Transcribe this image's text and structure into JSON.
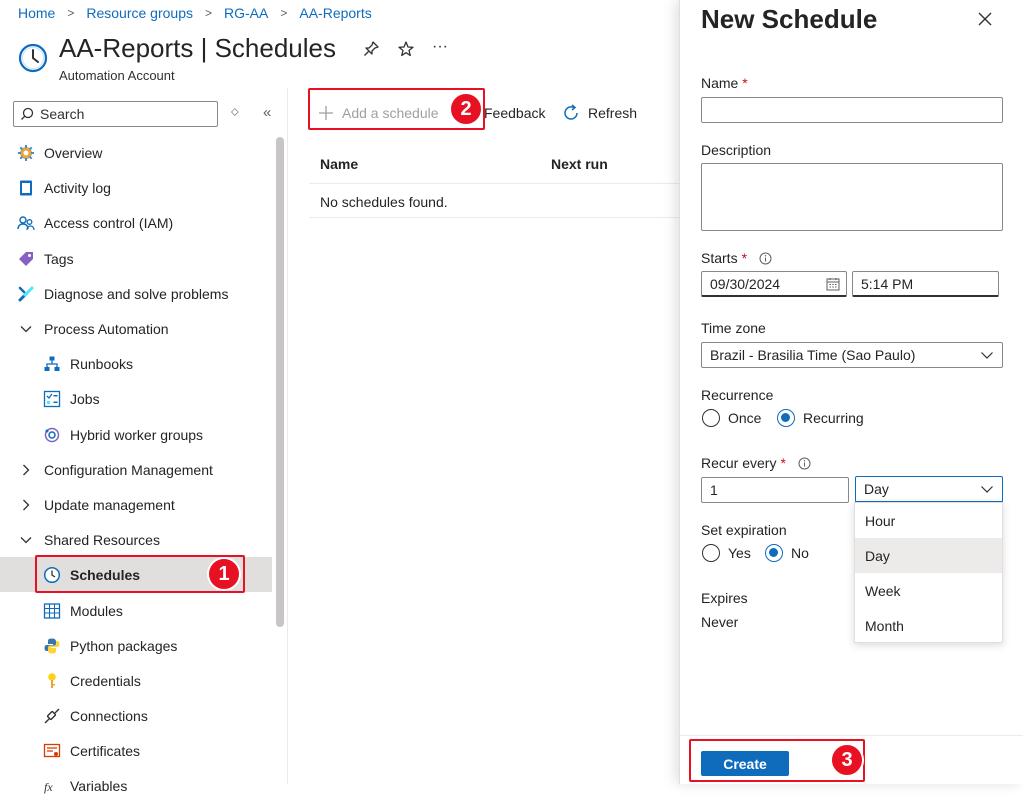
{
  "breadcrumb": {
    "items": [
      "Home",
      "Resource groups",
      "RG-AA",
      "AA-Reports"
    ],
    "separator": ">"
  },
  "header": {
    "title": "AA-Reports | Schedules",
    "subtitle": "Automation Account",
    "more_label": "···"
  },
  "search": {
    "placeholder": "Search"
  },
  "sidebar": {
    "items": [
      {
        "label": "Overview",
        "icon": "gear-icon"
      },
      {
        "label": "Activity log",
        "icon": "activity-log-icon"
      },
      {
        "label": "Access control (IAM)",
        "icon": "people-icon"
      },
      {
        "label": "Tags",
        "icon": "tag-icon"
      },
      {
        "label": "Diagnose and solve problems",
        "icon": "wrench-icon"
      },
      {
        "label": "Process Automation",
        "icon": "chevron-down-icon"
      },
      {
        "label": "Runbooks",
        "icon": "runbook-icon"
      },
      {
        "label": "Jobs",
        "icon": "jobs-icon"
      },
      {
        "label": "Hybrid worker groups",
        "icon": "hybrid-worker-icon"
      },
      {
        "label": "Configuration Management",
        "icon": "chevron-right-icon"
      },
      {
        "label": "Update management",
        "icon": "chevron-right-icon"
      },
      {
        "label": "Shared Resources",
        "icon": "chevron-down-icon"
      },
      {
        "label": "Schedules",
        "icon": "clock-icon"
      },
      {
        "label": "Modules",
        "icon": "modules-icon"
      },
      {
        "label": "Python packages",
        "icon": "python-icon"
      },
      {
        "label": "Credentials",
        "icon": "key-icon"
      },
      {
        "label": "Connections",
        "icon": "plug-icon"
      },
      {
        "label": "Certificates",
        "icon": "certificate-icon"
      },
      {
        "label": "Variables",
        "icon": "variables-icon"
      }
    ]
  },
  "toolbar": {
    "add_label": "Add a schedule",
    "feedback_label": "Feedback",
    "refresh_label": "Refresh"
  },
  "table": {
    "columns": [
      "Name",
      "Next run"
    ],
    "empty_text": "No schedules found."
  },
  "panel": {
    "title": "New Schedule",
    "name_label": "Name",
    "name_value": "",
    "required_mark": "*",
    "description_label": "Description",
    "description_value": "",
    "starts_label": "Starts",
    "start_date": "09/30/2024",
    "start_time": "5:14 PM",
    "timezone_label": "Time zone",
    "timezone_value": "Brazil - Brasilia Time (Sao Paulo)",
    "recurrence_label": "Recurrence",
    "recurrence_options": [
      "Once",
      "Recurring"
    ],
    "recurrence_selected": "Recurring",
    "recur_every_label": "Recur every",
    "recur_every_value": "1",
    "recur_unit": "Day",
    "recur_unit_options": [
      "Hour",
      "Day",
      "Week",
      "Month"
    ],
    "expiration_label": "Set expiration",
    "expiration_options": [
      "Yes",
      "No"
    ],
    "expiration_selected": "No",
    "expires_label": "Expires",
    "expires_value": "Never",
    "create_label": "Create"
  },
  "annotations": [
    "1",
    "2",
    "3"
  ],
  "colors": {
    "accent": "#0f6cbd",
    "annotation": "#e81123",
    "selected_nav": "#e1dfdd"
  }
}
